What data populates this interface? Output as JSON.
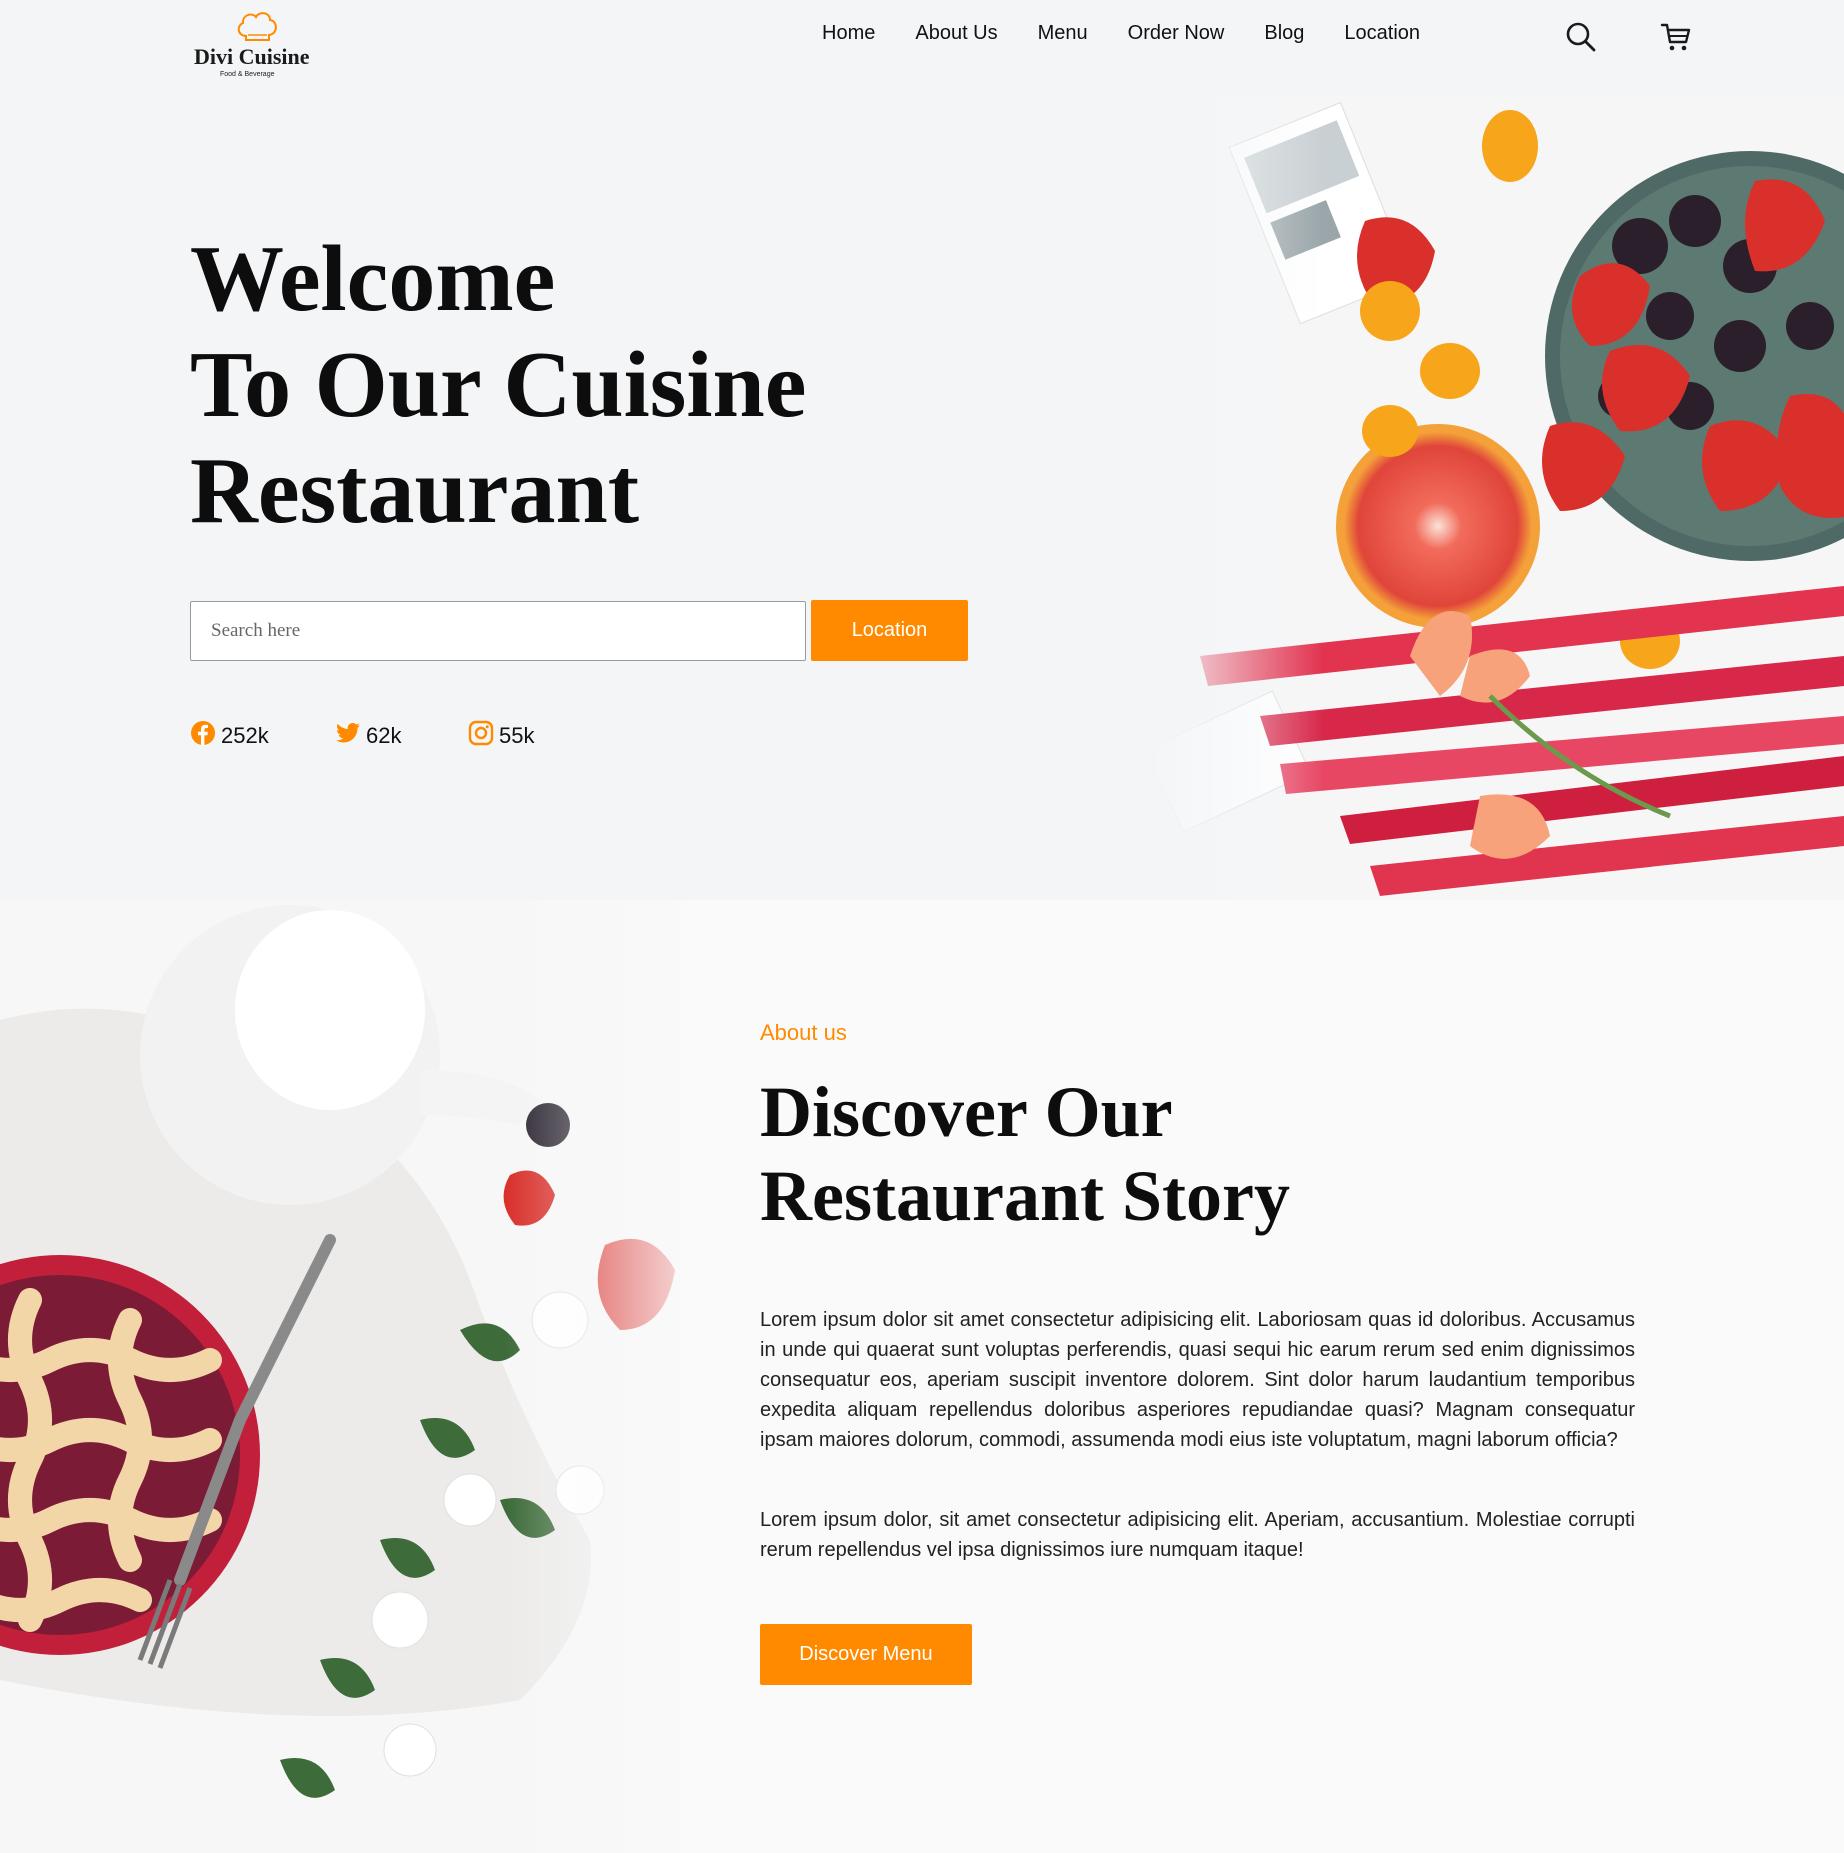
{
  "header": {
    "logo": {
      "brand": "Divi Cuisine",
      "tagline": "Food & Beverage"
    },
    "nav": [
      {
        "label": "Home"
      },
      {
        "label": "About Us"
      },
      {
        "label": "Menu"
      },
      {
        "label": "Order Now"
      },
      {
        "label": "Blog"
      },
      {
        "label": "Location"
      }
    ],
    "icons": [
      "search-icon",
      "cart-icon"
    ]
  },
  "hero": {
    "title_lines": [
      "Welcome",
      "To Our Cuisine",
      "Restaurant"
    ],
    "search_placeholder": "Search here",
    "search_value": "",
    "location_button": "Location",
    "socials": [
      {
        "icon": "facebook-icon",
        "count": "252k"
      },
      {
        "icon": "twitter-icon",
        "count": "62k"
      },
      {
        "icon": "instagram-icon",
        "count": "55k"
      }
    ]
  },
  "about": {
    "kicker": "About us",
    "title_lines": [
      "Discover Our",
      "Restaurant Story"
    ],
    "paragraph1": "Lorem ipsum dolor sit amet consectetur adipisicing elit. Laboriosam quas id doloribus. Accusamus in unde qui quaerat sunt voluptas perferendis, quasi sequi hic earum rerum sed enim dignissimos consequatur eos, aperiam suscipit inventore dolorem. Sint dolor harum laudantium temporibus expedita aliquam repellendus doloribus asperiores repudiandae quasi? Magnam consequatur ipsam maiores dolorum, commodi, assumenda modi eius iste voluptatum, magni laborum officia?",
    "paragraph2": "Lorem ipsum dolor, sit amet consectetur adipisicing elit. Aperiam, accusantium. Molestiae corrupti rerum repellendus vel ipsa dignissimos iure numquam itaque!",
    "discover_button": "Discover Menu"
  },
  "colors": {
    "accent": "#ff8a00",
    "page_bg": "#f3f5f7",
    "text": "#111111"
  }
}
